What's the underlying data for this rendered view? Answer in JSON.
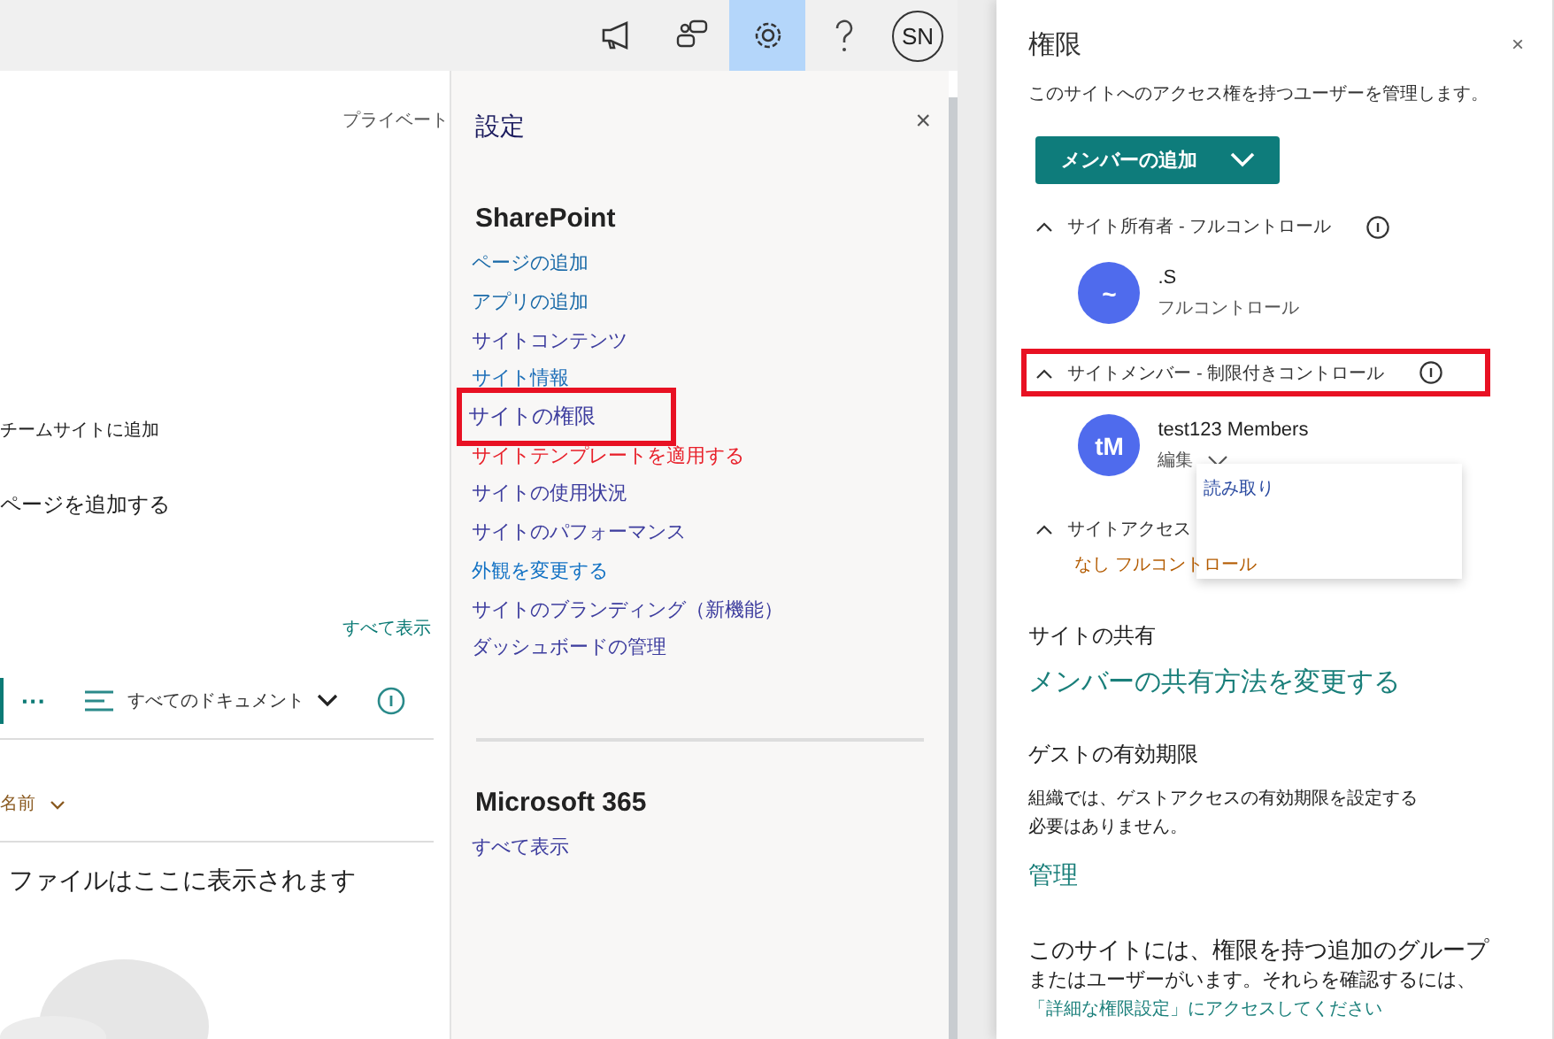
{
  "top_bar": {
    "buttons": [
      {
        "kind": "megaphone",
        "selected": false
      },
      {
        "kind": "chat",
        "selected": false
      },
      {
        "kind": "settings",
        "selected": true
      },
      {
        "kind": "help",
        "selected": false
      }
    ],
    "avatar_initials": "SN"
  },
  "page": {
    "privacy_label": "プライベート",
    "add_to_team_site": "チームサイトに追加",
    "add_page": "ページを追加する",
    "see_all": "すべて表示",
    "more": "···",
    "view_name": "すべてのドキュメント",
    "column_header": "名前",
    "empty_message": "ファイルはここに表示されます"
  },
  "settings_panel": {
    "title": "設定",
    "close": "×",
    "sections": [
      {
        "heading": "SharePoint",
        "items": [
          {
            "label": "ページの追加",
            "color": "#1a6aa8",
            "highlighted": false
          },
          {
            "label": "アプリの追加",
            "color": "#1a6aa8",
            "highlighted": false
          },
          {
            "label": "サイトコンテンツ",
            "color": "#3d3d9e",
            "highlighted": false
          },
          {
            "label": "サイト情報",
            "color": "#1e6fb8",
            "highlighted": false
          },
          {
            "label": "サイトの権限",
            "color": "#3d3d9e",
            "highlighted": true
          },
          {
            "label": "サイトテンプレートを適用する",
            "color": "#e8202a",
            "highlighted": false
          },
          {
            "label": "サイトの使用状況",
            "color": "#3d3d9e",
            "highlighted": false
          },
          {
            "label": "サイトのパフォーマンス",
            "color": "#3d3d9e",
            "highlighted": false
          },
          {
            "label": "外観を変更する",
            "color": "#1372c4",
            "highlighted": false
          },
          {
            "label": "サイトのブランディング（新機能）",
            "color": "#3d3d9e",
            "highlighted": false
          },
          {
            "label": "ダッシュボードの管理",
            "color": "#3d3d9e",
            "highlighted": false
          }
        ]
      },
      {
        "heading": "Microsoft 365",
        "items": [
          {
            "label": "すべて表示",
            "color": "#3d3d9e",
            "highlighted": false
          }
        ]
      }
    ]
  },
  "permissions_panel": {
    "title": "権限",
    "close": "×",
    "description": "このサイトへのアクセス権を持つユーザーを管理します。",
    "add_button": "メンバーの追加",
    "groups": [
      {
        "title": "サイト所有者 - フルコントロール",
        "expanded": true,
        "highlighted": false,
        "info": true,
        "members": [
          {
            "initials": "~",
            "name": ".S",
            "role": "フルコントロール",
            "kind": "text"
          }
        ]
      },
      {
        "title": "サイトメンバー - 制限付きコントロール",
        "expanded": true,
        "highlighted": true,
        "info": true,
        "members": [
          {
            "initials": "tM",
            "name": "test123 Members",
            "role": "編集",
            "kind": "dropdown",
            "expanded": true
          }
        ]
      },
      {
        "title": "サイトアクセス",
        "expanded": true,
        "highlighted": false,
        "info": false,
        "summary": "なし フルコントロール"
      }
    ],
    "role_menu": {
      "options": [
        {
          "label": "読み取り"
        }
      ]
    },
    "sharing": {
      "heading": "サイトの共有",
      "link": "メンバーの共有方法を変更する"
    },
    "guest": {
      "heading": "ゲストの有効期限",
      "lines": [
        "組織では、ゲストアクセスの有効期限を設定する",
        "必要はありません。"
      ],
      "link": "管理"
    },
    "footer": {
      "lines": [
        "このサイトには、権限を持つ追加のグループ",
        "またはユーザーがいます。それらを確認するには、"
      ],
      "link": "「詳細な権限設定」にアクセスしてください"
    }
  }
}
